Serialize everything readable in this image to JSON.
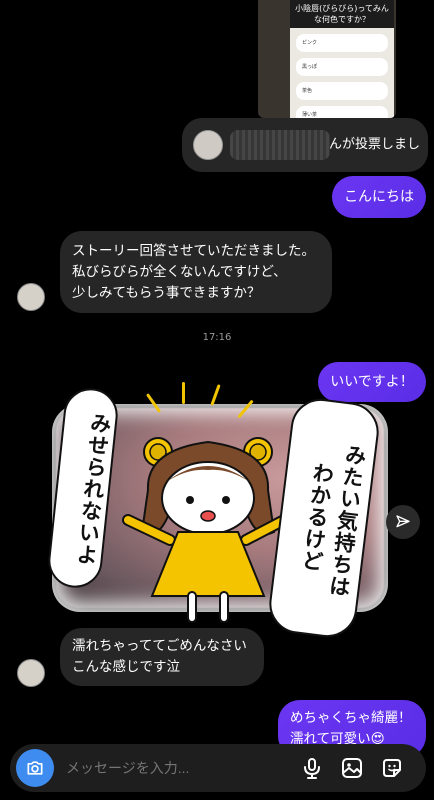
{
  "story": {
    "question": "小陰唇(びらびら)ってみんな何色ですか？",
    "options": [
      "ピンク",
      "黒っぽ",
      "茶色",
      "薄い茶"
    ]
  },
  "vote_notice": {
    "text": "んが投票しまし"
  },
  "messages": {
    "hello": "こんにちは",
    "story_reply_line1": "ストーリー回答させていただきました。",
    "story_reply_line2": "私びらびらが全くないんですけど、",
    "story_reply_line3": "少しみてもらう事できますか？",
    "timestamp": "17:16",
    "ok": "いいですよ！",
    "apology_line1": "濡れちゃっててごめんなさい",
    "apology_line2": "こんな感じです泣",
    "compliment_line1": "めちゃくちゃ綺麗！",
    "compliment_line2": "濡れて可愛い",
    "compliment_emoji": "😍"
  },
  "sticker": {
    "left_text": "みせられないよ",
    "right_line1": "みたい気持ちは",
    "right_line2": "わかるけど"
  },
  "composer": {
    "placeholder": "メッセージを入力..."
  },
  "colors": {
    "outgoing": "#5a2de6",
    "incoming": "#262626",
    "camera": "#3f8cf0"
  },
  "icons": [
    "camera-icon",
    "send-icon",
    "mic-icon",
    "gallery-icon",
    "sticker-icon"
  ]
}
